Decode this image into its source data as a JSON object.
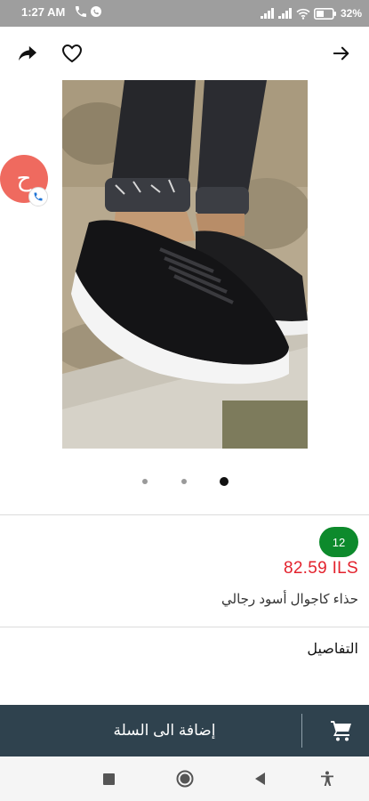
{
  "status_bar": {
    "time": "1:27 AM",
    "battery": "32%",
    "icons": [
      "call-icon",
      "whatsapp-icon",
      "signal-icon",
      "wifi-icon",
      "battery-icon"
    ]
  },
  "top_bar": {
    "icons": [
      "share-icon",
      "heart-icon",
      "arrow-right-icon"
    ]
  },
  "call_badge": {
    "letter": "ح"
  },
  "carousel": {
    "total": 3,
    "active": 3
  },
  "product": {
    "quantity": "12",
    "price": "82.59 ILS",
    "name": "حذاء كاجوال أسود رجالي",
    "details_label": "التفاصيل"
  },
  "cart": {
    "label": "إضافة الى السلة",
    "icon": "cart-icon"
  },
  "nav_bar": {
    "icons": [
      "recents-square-icon",
      "home-circle-icon",
      "back-triangle-icon",
      "accessibility-icon"
    ]
  },
  "colors": {
    "price": "#e3222d",
    "badge": "#0d8a2c",
    "cart_bar": "#2f424e",
    "call_badge": "#ef6a5f"
  }
}
